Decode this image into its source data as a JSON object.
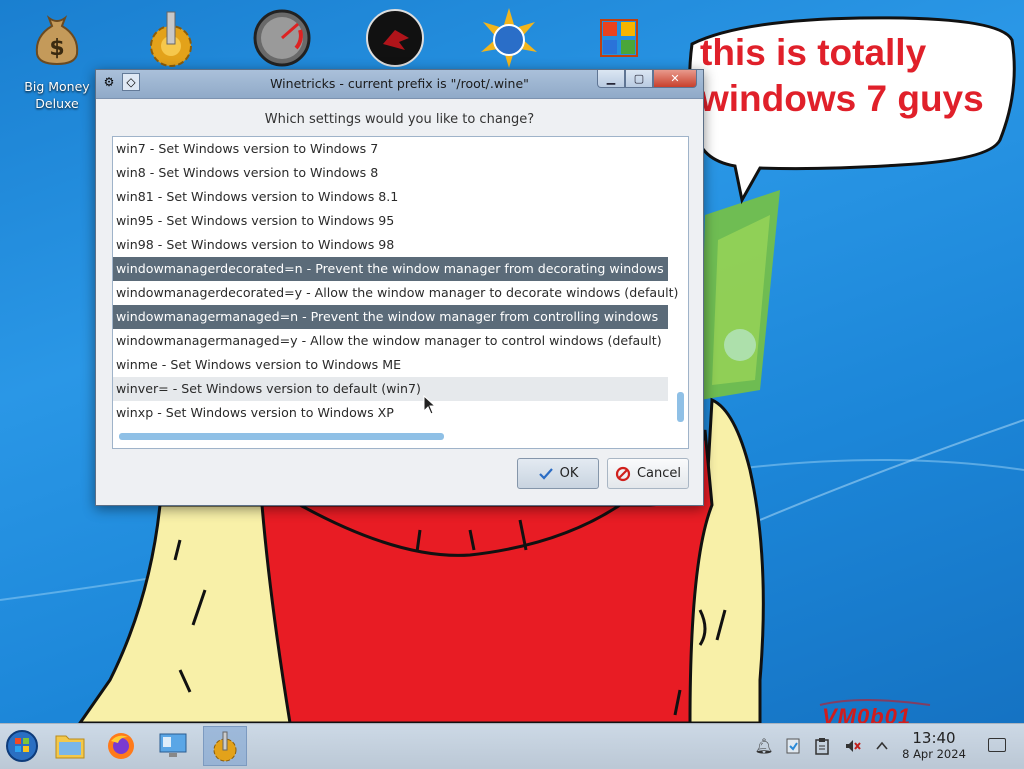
{
  "wallpaper": {
    "speech_bubble": [
      "this is totally",
      "windows 7 guys"
    ],
    "watermark": "VM0b01"
  },
  "desktop_icons": [
    {
      "label": "Big Money Deluxe",
      "icon": "money-bag-icon"
    },
    {
      "label": "",
      "icon": "gear-app-icon"
    },
    {
      "label": "",
      "icon": "speedometer-icon"
    },
    {
      "label": "",
      "icon": "dark-red-app-icon"
    },
    {
      "label": "",
      "icon": "sun-globe-app-icon"
    },
    {
      "label": "",
      "icon": "office-logo-icon"
    }
  ],
  "dialog": {
    "title": "Winetricks - current prefix is \"/root/.wine\"",
    "prompt": "Which settings would you like to change?",
    "items": [
      {
        "text": "win7 - Set Windows version to Windows 7",
        "state": "normal"
      },
      {
        "text": "win8 - Set Windows version to Windows 8",
        "state": "normal"
      },
      {
        "text": "win81 - Set Windows version to Windows 8.1",
        "state": "normal"
      },
      {
        "text": "win95 - Set Windows version to Windows 95",
        "state": "normal"
      },
      {
        "text": "win98 - Set Windows version to Windows 98",
        "state": "normal"
      },
      {
        "text": "windowmanagerdecorated=n - Prevent the window manager from decorating windows",
        "state": "selected"
      },
      {
        "text": "windowmanagerdecorated=y - Allow the window manager to decorate windows (default)",
        "state": "normal"
      },
      {
        "text": "windowmanagermanaged=n - Prevent the window manager from controlling windows",
        "state": "selected"
      },
      {
        "text": "windowmanagermanaged=y - Allow the window manager to control windows (default)",
        "state": "normal"
      },
      {
        "text": "winme - Set Windows version to Windows ME",
        "state": "normal"
      },
      {
        "text": "winver= - Set Windows version to default (win7)",
        "state": "hover"
      },
      {
        "text": "winxp - Set Windows version to Windows XP",
        "state": "normal"
      }
    ],
    "ok_label": "OK",
    "cancel_label": "Cancel"
  },
  "taskbar": {
    "apps": [
      {
        "name": "start-button",
        "icon": "windows-orb-icon"
      },
      {
        "name": "file-manager",
        "icon": "folder-icon"
      },
      {
        "name": "firefox",
        "icon": "firefox-icon"
      },
      {
        "name": "system-settings",
        "icon": "monitor-settings-icon"
      },
      {
        "name": "winetricks",
        "icon": "gear-app-icon",
        "active": true
      }
    ],
    "tray": [
      "bell-icon",
      "updates-icon",
      "clipboard-icon",
      "volume-muted-icon",
      "chevron-up-icon"
    ],
    "clock": {
      "time": "13:40",
      "date": "8 Apr 2024"
    }
  }
}
